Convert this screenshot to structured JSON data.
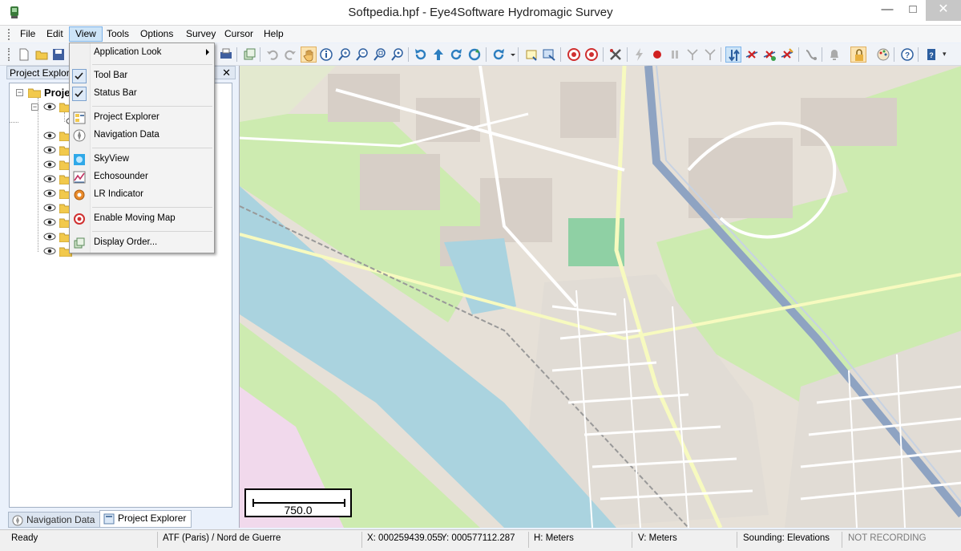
{
  "window": {
    "title": "Softpedia.hpf - Eye4Software Hydromagic Survey",
    "minimize_glyph": "—",
    "maximize_glyph": "□",
    "close_glyph": "✕"
  },
  "menubar": {
    "items": [
      {
        "label": "File"
      },
      {
        "label": "Edit"
      },
      {
        "label": "View"
      },
      {
        "label": "Tools"
      },
      {
        "label": "Options"
      },
      {
        "label": "Survey"
      },
      {
        "label": "Cursor"
      },
      {
        "label": "Help"
      }
    ],
    "active": "View"
  },
  "toolbar": {
    "icons": [
      "new-file-icon",
      "open-folder-icon",
      "save-icon",
      "print-icon",
      "layers-icon",
      "undo-icon",
      "redo-icon",
      "pan-hand-icon",
      "info-icon",
      "zoom-in-icon",
      "zoom-out-icon",
      "zoom-window-icon",
      "zoom-extents-icon",
      "rotate-left-icon",
      "arrow-up-icon",
      "rotate-right-icon",
      "refresh-icon",
      "sync-icon",
      "note-icon",
      "export-icon",
      "target-icon",
      "target-alt-icon",
      "tools-icon",
      "lightning-icon",
      "record-icon",
      "pause-icon",
      "antenna-icon",
      "antenna-alt-icon",
      "swap-icon",
      "crossline-icon",
      "crossline-add-icon",
      "crossline-edit-icon",
      "pipe-icon",
      "bell-icon",
      "lock-icon",
      "palette-icon",
      "help-icon",
      "book-icon"
    ],
    "overflow_glyph": "▾"
  },
  "view_menu": {
    "items": [
      {
        "label": "Application Look",
        "icon": "",
        "submenu": true
      },
      {
        "label": "Tool Bar",
        "checked": true
      },
      {
        "label": "Status Bar",
        "checked": true
      },
      {
        "label": "Project Explorer",
        "icon": "project-explorer-icon"
      },
      {
        "label": "Navigation Data",
        "icon": "compass-icon"
      },
      {
        "label": "SkyView",
        "icon": "skyview-icon"
      },
      {
        "label": "Echosounder",
        "icon": "echosounder-icon"
      },
      {
        "label": "LR Indicator",
        "icon": "gear-icon"
      },
      {
        "label": "Enable Moving Map",
        "icon": "target-icon"
      },
      {
        "label": "Display Order...",
        "icon": "display-order-icon"
      }
    ]
  },
  "project_explorer": {
    "title": "Project Explorer",
    "close_glyph": "✕",
    "root_label": "Proje",
    "root_expander": "−",
    "child_expander": "−",
    "tabs": [
      {
        "label": "Navigation Data",
        "active": false
      },
      {
        "label": "Project Explorer",
        "active": true
      }
    ]
  },
  "map": {
    "scale_label": "750.0"
  },
  "statusbar": {
    "ready": "Ready",
    "datum": "ATF (Paris) / Nord de Guerre",
    "x_coord": "X: 000259439.055",
    "y_coord": "Y: 000577112.287",
    "h_units": "H: Meters",
    "v_units": "V: Meters",
    "sounding": "Sounding: Elevations",
    "recording": "NOT RECORDING"
  },
  "colors": {
    "map_land": "#e8e0d8",
    "map_water": "#aad3df",
    "map_green": "#cdebb0",
    "map_industrial": "#d5cfc8",
    "map_road_major": "#f7fabf",
    "map_motorway": "#8ea3c2",
    "accent": "#3c7fb1"
  }
}
